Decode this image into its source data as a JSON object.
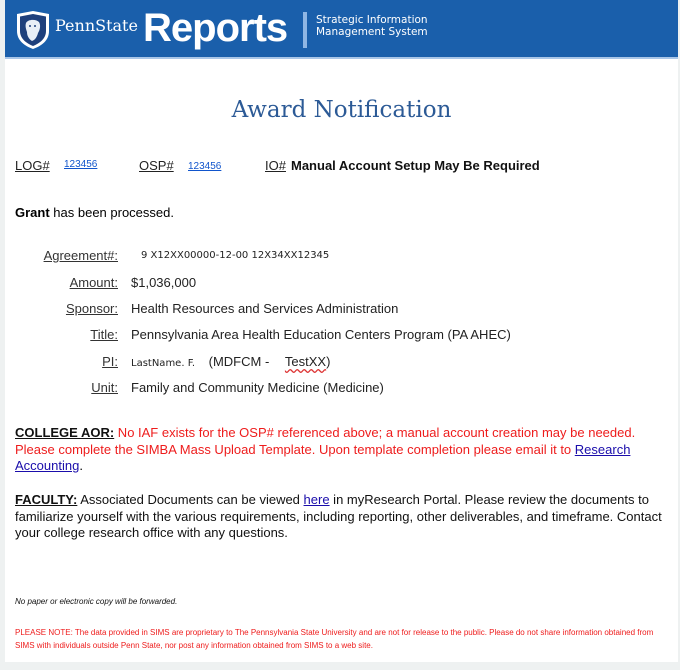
{
  "header": {
    "brand": "PennState",
    "product": "Reports",
    "subtitle_line1": "Strategic Information",
    "subtitle_line2": "Management System",
    "banner_color": "#1a5fab"
  },
  "title": "Award Notification",
  "ids": {
    "log_label": "LOG#",
    "log_value": "123456",
    "osp_label": "OSP#",
    "osp_value": "123456",
    "io_label": "IO#",
    "io_value": "Manual Account Setup May Be Required"
  },
  "status": {
    "bold": "Grant",
    "text": " has been processed."
  },
  "fields": {
    "agreement": {
      "label": "Agreement#:",
      "value": "9 X12XX00000-12-00 12X34XX12345"
    },
    "amount": {
      "label": "Amount:",
      "value": "$1,036,000"
    },
    "sponsor": {
      "label": "Sponsor:",
      "value": "Health Resources and Services Administration"
    },
    "title": {
      "label": "Title:",
      "value": "Pennsylvania Area Health Education Centers Program (PA AHEC)"
    },
    "pi": {
      "label": "PI:",
      "name": "LastName. F.",
      "dept": "(MDFCM -",
      "code": "TestXX",
      "close": ")"
    },
    "unit": {
      "label": "Unit:",
      "value": "Family and Community Medicine (Medicine)"
    }
  },
  "college_aor": {
    "label": "COLLEGE AOR:",
    "text": " No IAF exists for the OSP# referenced above; a manual account creation may be needed. Please complete the SIMBA Mass Upload Template. Upon template completion please email it to ",
    "link": "Research Accounting",
    "end": "."
  },
  "faculty": {
    "label": "FACULTY:",
    "text1": " Associated Documents can be viewed ",
    "link": "here",
    "text2": " in myResearch Portal. Please review the documents to familiarize yourself with the various requirements, including reporting, other deliverables, and timeframe. Contact your college research office with any questions."
  },
  "footer": {
    "note": "No paper or electronic copy will be forwarded.",
    "disclaimer": "PLEASE NOTE: The data provided in SIMS are proprietary to The Pennsylvania State University and are not for release to the public. Please do not share information obtained from SIMS with individuals outside Penn State, nor post any information obtained from SIMS to a web site."
  }
}
